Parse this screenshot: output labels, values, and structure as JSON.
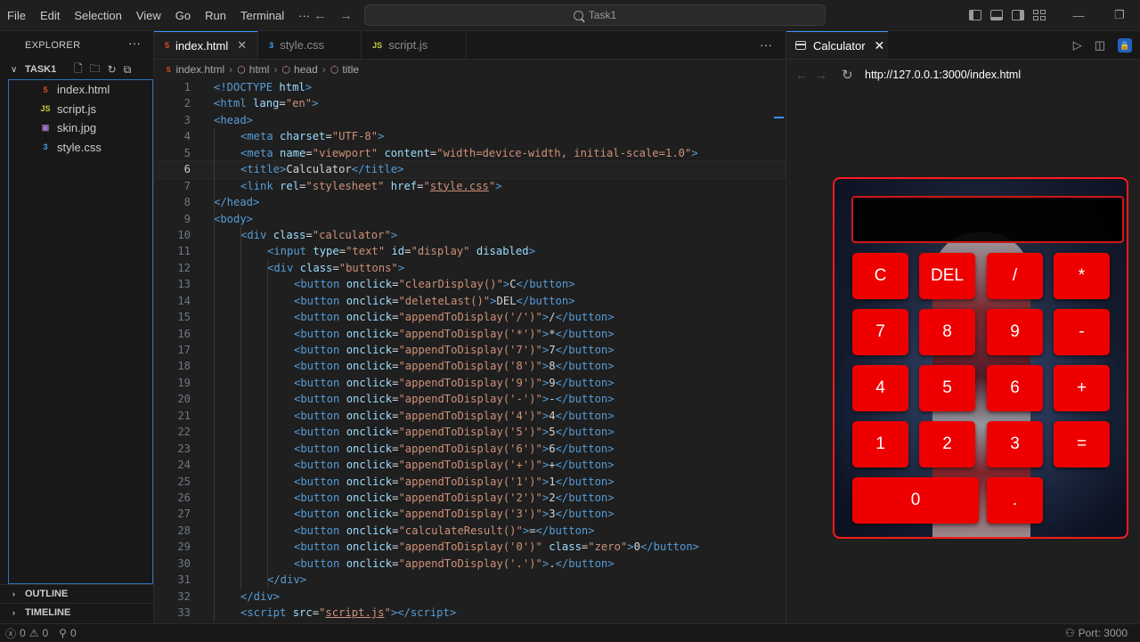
{
  "menu": [
    "File",
    "Edit",
    "Selection",
    "View",
    "Go",
    "Run",
    "Terminal",
    "···"
  ],
  "command_center": "Task1",
  "explorer": {
    "title": "EXPLORER",
    "folder": "TASK1",
    "files": [
      {
        "name": "index.html",
        "icon": "5",
        "type": "html"
      },
      {
        "name": "script.js",
        "icon": "JS",
        "type": "js"
      },
      {
        "name": "skin.jpg",
        "icon": "▣",
        "type": "img"
      },
      {
        "name": "style.css",
        "icon": "3",
        "type": "css"
      }
    ],
    "outline": "OUTLINE",
    "timeline": "TIMELINE"
  },
  "editor": {
    "tabs": [
      {
        "label": "index.html",
        "icon": "5",
        "type": "html",
        "active": true
      },
      {
        "label": "style.css",
        "icon": "3",
        "type": "css",
        "active": false
      },
      {
        "label": "script.js",
        "icon": "JS",
        "type": "js",
        "active": false
      }
    ],
    "breadcrumb": [
      "index.html",
      "html",
      "head",
      "title"
    ],
    "current_line": 6,
    "lines": [
      {
        "n": 1,
        "indent": 0,
        "html": "<span class='t'>&lt;!DOCTYPE</span> <span class='a'>html</span><span class='t'>&gt;</span>"
      },
      {
        "n": 2,
        "indent": 0,
        "html": "<span class='t'>&lt;html</span> <span class='a'>lang</span>=<span class='s'>\"en\"</span><span class='t'>&gt;</span>"
      },
      {
        "n": 3,
        "indent": 0,
        "html": "<span class='t'>&lt;head&gt;</span>"
      },
      {
        "n": 4,
        "indent": 1,
        "html": "<span class='t'>&lt;meta</span> <span class='a'>charset</span>=<span class='s'>\"UTF-8\"</span><span class='t'>&gt;</span>"
      },
      {
        "n": 5,
        "indent": 1,
        "html": "<span class='t'>&lt;meta</span> <span class='a'>name</span>=<span class='s'>\"viewport\"</span> <span class='a'>content</span>=<span class='s'>\"width=device-width, initial-scale=1.0\"</span><span class='t'>&gt;</span>"
      },
      {
        "n": 6,
        "indent": 1,
        "html": "<span class='t'>&lt;title&gt;</span>Calculator<span class='t'>&lt;/title&gt;</span>"
      },
      {
        "n": 7,
        "indent": 1,
        "html": "<span class='t'>&lt;link</span> <span class='a'>rel</span>=<span class='s'>\"stylesheet\"</span> <span class='a'>href</span>=<span class='s'>\"<u>style.css</u>\"</span><span class='t'>&gt;</span>"
      },
      {
        "n": 8,
        "indent": 0,
        "html": "<span class='t'>&lt;/head&gt;</span>"
      },
      {
        "n": 9,
        "indent": 0,
        "html": "<span class='t'>&lt;body&gt;</span>"
      },
      {
        "n": 10,
        "indent": 1,
        "html": "<span class='t'>&lt;div</span> <span class='a'>class</span>=<span class='s'>\"calculator\"</span><span class='t'>&gt;</span>"
      },
      {
        "n": 11,
        "indent": 2,
        "html": "<span class='t'>&lt;input</span> <span class='a'>type</span>=<span class='s'>\"text\"</span> <span class='a'>id</span>=<span class='s'>\"display\"</span> <span class='a'>disabled</span><span class='t'>&gt;</span>"
      },
      {
        "n": 12,
        "indent": 2,
        "html": "<span class='t'>&lt;div</span> <span class='a'>class</span>=<span class='s'>\"buttons\"</span><span class='t'>&gt;</span>"
      },
      {
        "n": 13,
        "indent": 3,
        "html": "<span class='t'>&lt;button</span> <span class='a'>onclick</span>=<span class='s'>\"clearDisplay()\"</span><span class='t'>&gt;</span>C<span class='t'>&lt;/button&gt;</span>"
      },
      {
        "n": 14,
        "indent": 3,
        "html": "<span class='t'>&lt;button</span> <span class='a'>onclick</span>=<span class='s'>\"deleteLast()\"</span><span class='t'>&gt;</span>DEL<span class='t'>&lt;/button&gt;</span>"
      },
      {
        "n": 15,
        "indent": 3,
        "html": "<span class='t'>&lt;button</span> <span class='a'>onclick</span>=<span class='s'>\"appendToDisplay('/')\"</span><span class='t'>&gt;</span>/<span class='t'>&lt;/button&gt;</span>"
      },
      {
        "n": 16,
        "indent": 3,
        "html": "<span class='t'>&lt;button</span> <span class='a'>onclick</span>=<span class='s'>\"appendToDisplay('*')\"</span><span class='t'>&gt;</span>*<span class='t'>&lt;/button&gt;</span>"
      },
      {
        "n": 17,
        "indent": 3,
        "html": "<span class='t'>&lt;button</span> <span class='a'>onclick</span>=<span class='s'>\"appendToDisplay('7')\"</span><span class='t'>&gt;</span>7<span class='t'>&lt;/button&gt;</span>"
      },
      {
        "n": 18,
        "indent": 3,
        "html": "<span class='t'>&lt;button</span> <span class='a'>onclick</span>=<span class='s'>\"appendToDisplay('8')\"</span><span class='t'>&gt;</span>8<span class='t'>&lt;/button&gt;</span>"
      },
      {
        "n": 19,
        "indent": 3,
        "html": "<span class='t'>&lt;button</span> <span class='a'>onclick</span>=<span class='s'>\"appendToDisplay('9')\"</span><span class='t'>&gt;</span>9<span class='t'>&lt;/button&gt;</span>"
      },
      {
        "n": 20,
        "indent": 3,
        "html": "<span class='t'>&lt;button</span> <span class='a'>onclick</span>=<span class='s'>\"appendToDisplay('-')\"</span><span class='t'>&gt;</span>-<span class='t'>&lt;/button&gt;</span>"
      },
      {
        "n": 21,
        "indent": 3,
        "html": "<span class='t'>&lt;button</span> <span class='a'>onclick</span>=<span class='s'>\"appendToDisplay('4')\"</span><span class='t'>&gt;</span>4<span class='t'>&lt;/button&gt;</span>"
      },
      {
        "n": 22,
        "indent": 3,
        "html": "<span class='t'>&lt;button</span> <span class='a'>onclick</span>=<span class='s'>\"appendToDisplay('5')\"</span><span class='t'>&gt;</span>5<span class='t'>&lt;/button&gt;</span>"
      },
      {
        "n": 23,
        "indent": 3,
        "html": "<span class='t'>&lt;button</span> <span class='a'>onclick</span>=<span class='s'>\"appendToDisplay('6')\"</span><span class='t'>&gt;</span>6<span class='t'>&lt;/button&gt;</span>"
      },
      {
        "n": 24,
        "indent": 3,
        "html": "<span class='t'>&lt;button</span> <span class='a'>onclick</span>=<span class='s'>\"appendToDisplay('+')\"</span><span class='t'>&gt;</span>+<span class='t'>&lt;/button&gt;</span>"
      },
      {
        "n": 25,
        "indent": 3,
        "html": "<span class='t'>&lt;button</span> <span class='a'>onclick</span>=<span class='s'>\"appendToDisplay('1')\"</span><span class='t'>&gt;</span>1<span class='t'>&lt;/button&gt;</span>"
      },
      {
        "n": 26,
        "indent": 3,
        "html": "<span class='t'>&lt;button</span> <span class='a'>onclick</span>=<span class='s'>\"appendToDisplay('2')\"</span><span class='t'>&gt;</span>2<span class='t'>&lt;/button&gt;</span>"
      },
      {
        "n": 27,
        "indent": 3,
        "html": "<span class='t'>&lt;button</span> <span class='a'>onclick</span>=<span class='s'>\"appendToDisplay('3')\"</span><span class='t'>&gt;</span>3<span class='t'>&lt;/button&gt;</span>"
      },
      {
        "n": 28,
        "indent": 3,
        "html": "<span class='t'>&lt;button</span> <span class='a'>onclick</span>=<span class='s'>\"calculateResult()\"</span><span class='t'>&gt;</span>=<span class='t'>&lt;/button&gt;</span>"
      },
      {
        "n": 29,
        "indent": 3,
        "html": "<span class='t'>&lt;button</span> <span class='a'>onclick</span>=<span class='s'>\"appendToDisplay('0')\"</span> <span class='a'>class</span>=<span class='s'>\"zero\"</span><span class='t'>&gt;</span>0<span class='t'>&lt;/button&gt;</span>"
      },
      {
        "n": 30,
        "indent": 3,
        "html": "<span class='t'>&lt;button</span> <span class='a'>onclick</span>=<span class='s'>\"appendToDisplay('.')\"</span><span class='t'>&gt;</span>.<span class='t'>&lt;/button&gt;</span>"
      },
      {
        "n": 31,
        "indent": 2,
        "html": "<span class='t'>&lt;/div&gt;</span>"
      },
      {
        "n": 32,
        "indent": 1,
        "html": "<span class='t'>&lt;/div&gt;</span>"
      },
      {
        "n": 33,
        "indent": 1,
        "html": "<span class='t'>&lt;script</span> <span class='a'>src</span>=<span class='s'>\"<u>script.js</u>\"</span><span class='t'>&gt;&lt;/script&gt;</span>"
      }
    ]
  },
  "preview": {
    "tab_label": "Calculator",
    "url": "http://127.0.0.1:3000/index.html",
    "display_value": "",
    "buttons": [
      {
        "label": "C",
        "name": "clear"
      },
      {
        "label": "DEL",
        "name": "delete"
      },
      {
        "label": "/",
        "name": "divide"
      },
      {
        "label": "*",
        "name": "multiply"
      },
      {
        "label": "7",
        "name": "seven"
      },
      {
        "label": "8",
        "name": "eight"
      },
      {
        "label": "9",
        "name": "nine"
      },
      {
        "label": "-",
        "name": "minus"
      },
      {
        "label": "4",
        "name": "four"
      },
      {
        "label": "5",
        "name": "five"
      },
      {
        "label": "6",
        "name": "six"
      },
      {
        "label": "+",
        "name": "plus"
      },
      {
        "label": "1",
        "name": "one"
      },
      {
        "label": "2",
        "name": "two"
      },
      {
        "label": "3",
        "name": "three"
      },
      {
        "label": "=",
        "name": "equals"
      },
      {
        "label": "0",
        "name": "zero"
      },
      {
        "label": ".",
        "name": "decimal"
      }
    ]
  },
  "status": {
    "errors": "0",
    "warnings": "0",
    "ports_forwarded": "0",
    "port": "Port: 3000"
  },
  "colors": {
    "accent": "#3794ff",
    "calc_red": "#ee0000",
    "tag": "#569cd6",
    "attr": "#9cdcfe",
    "string": "#ce9178"
  }
}
